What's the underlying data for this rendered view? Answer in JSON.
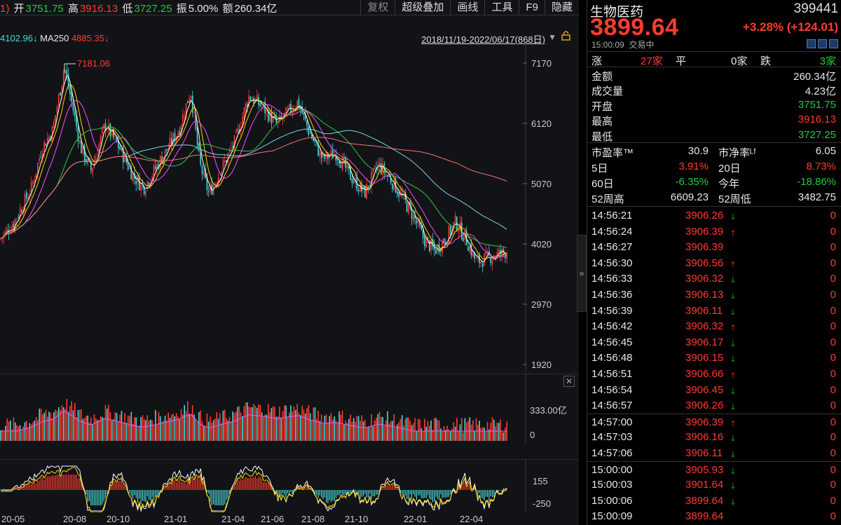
{
  "toolbar": {
    "ohlc": {
      "prefix": "1)",
      "open_label": "开",
      "open": "3751.75",
      "high_label": "高",
      "high": "3916.13",
      "low_label": "低",
      "low": "3727.25",
      "amp_label": "振",
      "amp": "5.00%",
      "amount_label": "额",
      "amount": "260.34亿"
    },
    "buttons": [
      "复权",
      "超级叠加",
      "画线",
      "工具",
      "F9",
      "隐藏"
    ]
  },
  "ma_legend": {
    "ma_prev_value": "4102.96↓",
    "ma250_label": "MA250",
    "ma250_value": "4885.35↓"
  },
  "range_label": "2018/11/19-2022/06/17(868日)",
  "main_axis": {
    "y_labels": [
      "7170",
      "6120",
      "5070",
      "4020",
      "2970",
      "1920"
    ],
    "peak_label": "7181.06"
  },
  "volume_axis": {
    "labels": [
      "333.00亿",
      "0"
    ]
  },
  "macd_axis": {
    "labels": [
      "155",
      "-250"
    ]
  },
  "x_labels": [
    "20-05",
    "20-08",
    "20-10",
    "21-01",
    "21-04",
    "21-06",
    "21-08",
    "21-10",
    "22-01",
    "22-04"
  ],
  "colors": {
    "up": "#ff3b30",
    "down": "#27c93f",
    "cyan": "#4ad9d9",
    "bg": "#111317"
  },
  "chart_data": {
    "type": "candlestick",
    "x": [
      "20-05",
      "20-08",
      "20-10",
      "21-01",
      "21-04",
      "21-06",
      "21-08",
      "21-10",
      "22-01",
      "22-04"
    ],
    "close_approx": [
      4200,
      6900,
      5400,
      5600,
      6300,
      6000,
      5500,
      5100,
      4000,
      3700
    ],
    "ylim": [
      1920,
      7170
    ],
    "peak": 7181.06
  },
  "quote": {
    "name": "生物医药",
    "code": "399441",
    "price": "3899.64",
    "change": "+3.28% (+124.01)",
    "time": "15:00:09",
    "status": "交易中",
    "breadth": {
      "up_label": "涨",
      "up": "27家",
      "flat_label": "平",
      "flat": "0家",
      "down_label": "跌",
      "down": "3家"
    },
    "stats": [
      {
        "label": "金额",
        "value": "260.34亿",
        "color": "white"
      },
      {
        "label": "成交量",
        "value": "4.23亿",
        "color": "white"
      },
      {
        "label": "开盘",
        "value": "3751.75",
        "color": "green"
      },
      {
        "label": "最高",
        "value": "3916.13",
        "color": "red"
      },
      {
        "label": "最低",
        "value": "3727.25",
        "color": "green"
      }
    ],
    "ratios": [
      {
        "l1": "市盈率™",
        "v1": "30.9",
        "c1": "white",
        "l2": "市净率ᴸᶠ",
        "v2": "6.05",
        "c2": "white"
      },
      {
        "l1": "5日",
        "v1": "3.91%",
        "c1": "red",
        "l2": "20日",
        "v2": "8.73%",
        "c2": "red"
      },
      {
        "l1": "60日",
        "v1": "-6.35%",
        "c1": "green",
        "l2": "今年",
        "v2": "-18.86%",
        "c2": "green"
      },
      {
        "l1": "52周高",
        "v1": "6609.23",
        "c1": "white",
        "l2": "52周低",
        "v2": "3482.75",
        "c2": "white"
      }
    ]
  },
  "ticks": [
    {
      "time": "14:56:21",
      "price": "3906.26",
      "dir": "down",
      "vol": "0"
    },
    {
      "time": "14:56:24",
      "price": "3906.39",
      "dir": "up",
      "vol": "0"
    },
    {
      "time": "14:56:27",
      "price": "3906.39",
      "dir": "",
      "vol": "0"
    },
    {
      "time": "14:56:30",
      "price": "3906.56",
      "dir": "up",
      "vol": "0"
    },
    {
      "time": "14:56:33",
      "price": "3906.32",
      "dir": "down",
      "vol": "0"
    },
    {
      "time": "14:56:36",
      "price": "3906.13",
      "dir": "down",
      "vol": "0"
    },
    {
      "time": "14:56:39",
      "price": "3906.11",
      "dir": "down",
      "vol": "0"
    },
    {
      "time": "14:56:42",
      "price": "3906.32",
      "dir": "up",
      "vol": "0"
    },
    {
      "time": "14:56:45",
      "price": "3906.17",
      "dir": "down",
      "vol": "0"
    },
    {
      "time": "14:56:48",
      "price": "3906.15",
      "dir": "down",
      "vol": "0"
    },
    {
      "time": "14:56:51",
      "price": "3906.66",
      "dir": "up",
      "vol": "0"
    },
    {
      "time": "14:56:54",
      "price": "3906.45",
      "dir": "down",
      "vol": "0"
    },
    {
      "time": "14:56:57",
      "price": "3906.26",
      "dir": "down",
      "vol": "0"
    },
    {
      "time": "14:57:00",
      "price": "3906.39",
      "dir": "up",
      "vol": "0"
    },
    {
      "time": "14:57:03",
      "price": "3906.16",
      "dir": "down",
      "vol": "0"
    },
    {
      "time": "14:57:06",
      "price": "3906.11",
      "dir": "down",
      "vol": "0"
    },
    {
      "time": "15:00:00",
      "price": "3905.93",
      "dir": "down",
      "vol": "0"
    },
    {
      "time": "15:00:03",
      "price": "3901.64",
      "dir": "down",
      "vol": "0"
    },
    {
      "time": "15:00:06",
      "price": "3899.64",
      "dir": "down",
      "vol": "0"
    },
    {
      "time": "15:00:09",
      "price": "3899.64",
      "dir": "",
      "vol": "0"
    }
  ]
}
